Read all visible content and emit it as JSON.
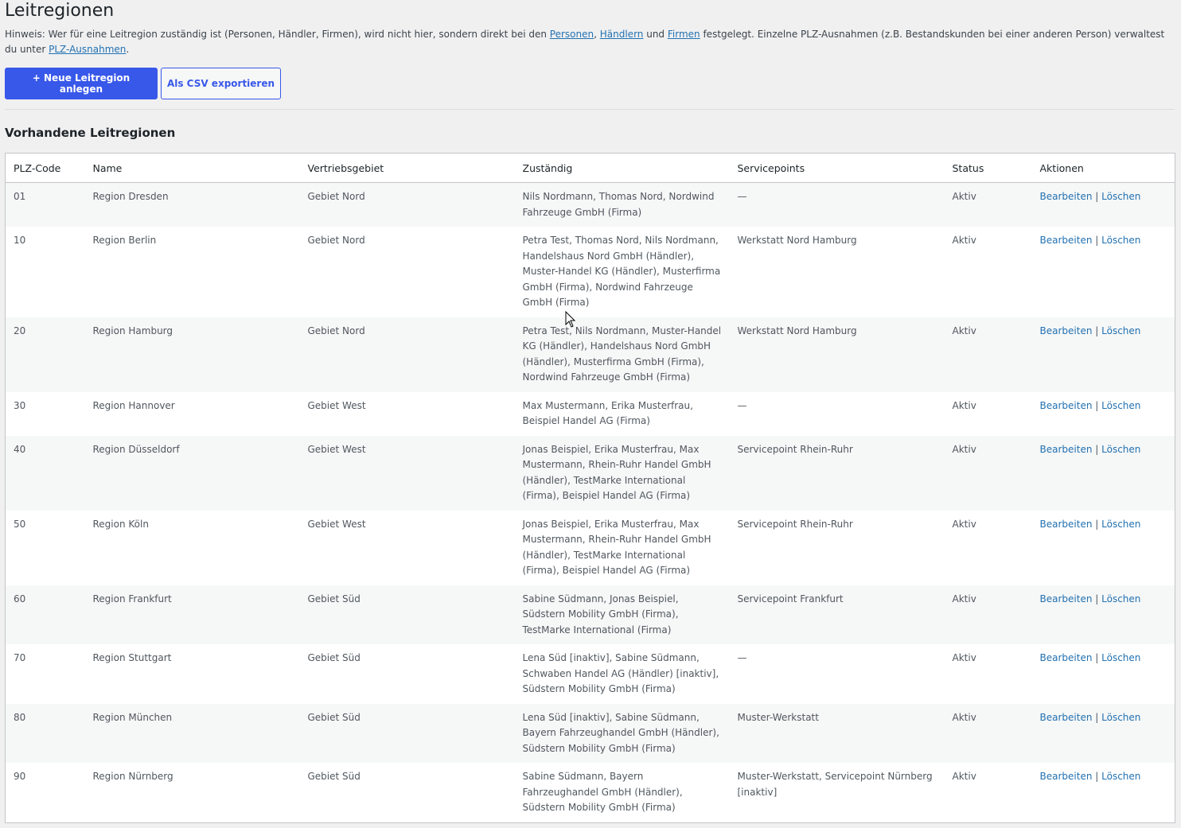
{
  "page": {
    "title": "Leitregionen",
    "hint_prefix": "Hinweis: Wer für eine Leitregion zuständig ist (Personen, Händler, Firmen), wird nicht hier, sondern direkt bei den ",
    "link_personen": "Personen",
    "comma": ",",
    "link_haendlern": "Händlern",
    "und": " und ",
    "link_firmen": "Firmen",
    "hint_mid": " festgelegt. Einzelne PLZ-Ausnahmen (z.B. Bestandskunden bei einer anderen Person) verwaltest du unter ",
    "link_ausnahmen": "PLZ-Ausnahmen",
    "hint_end": "."
  },
  "buttons": {
    "new_label": "+ Neue Leitregion anlegen",
    "export_label": "Als CSV exportieren"
  },
  "section": {
    "title": "Vorhandene Leitregionen"
  },
  "table": {
    "columns": [
      "PLZ-Code",
      "Name",
      "Vertriebsgebiet",
      "Zuständig",
      "Servicepoints",
      "Status",
      "Aktionen"
    ],
    "rows": [
      {
        "plz": "01",
        "name": "Region Dresden",
        "gebiet": "Gebiet Nord",
        "zustaendig": "Nils Nordmann, Thomas Nord, Nordwind Fahrzeuge GmbH (Firma)",
        "service": "—",
        "status": "Aktiv"
      },
      {
        "plz": "10",
        "name": "Region Berlin",
        "gebiet": "Gebiet Nord",
        "zustaendig": "Petra Test, Thomas Nord, Nils Nordmann, Handelshaus Nord GmbH (Händler), Muster-Handel KG (Händler), Musterfirma GmbH (Firma), Nordwind Fahrzeuge GmbH (Firma)",
        "service": "Werkstatt Nord Hamburg",
        "status": "Aktiv"
      },
      {
        "plz": "20",
        "name": "Region Hamburg",
        "gebiet": "Gebiet Nord",
        "zustaendig": "Petra Test, Nils Nordmann, Muster-Handel KG (Händler), Handelshaus Nord GmbH (Händler), Musterfirma GmbH (Firma), Nordwind Fahrzeuge GmbH (Firma)",
        "service": "Werkstatt Nord Hamburg",
        "status": "Aktiv"
      },
      {
        "plz": "30",
        "name": "Region Hannover",
        "gebiet": "Gebiet West",
        "zustaendig": "Max Mustermann, Erika Musterfrau, Beispiel Handel AG (Firma)",
        "service": "—",
        "status": "Aktiv"
      },
      {
        "plz": "40",
        "name": "Region Düsseldorf",
        "gebiet": "Gebiet West",
        "zustaendig": "Jonas Beispiel, Erika Musterfrau, Max Mustermann, Rhein-Ruhr Handel GmbH (Händler), TestMarke International (Firma), Beispiel Handel AG (Firma)",
        "service": "Servicepoint Rhein-Ruhr",
        "status": "Aktiv"
      },
      {
        "plz": "50",
        "name": "Region Köln",
        "gebiet": "Gebiet West",
        "zustaendig": "Jonas Beispiel, Erika Musterfrau, Max Mustermann, Rhein-Ruhr Handel GmbH (Händler), TestMarke International (Firma), Beispiel Handel AG (Firma)",
        "service": "Servicepoint Rhein-Ruhr",
        "status": "Aktiv"
      },
      {
        "plz": "60",
        "name": "Region Frankfurt",
        "gebiet": "Gebiet Süd",
        "zustaendig": "Sabine Südmann, Jonas Beispiel, Südstern Mobility GmbH (Firma), TestMarke International (Firma)",
        "service": "Servicepoint Frankfurt",
        "status": "Aktiv"
      },
      {
        "plz": "70",
        "name": "Region Stuttgart",
        "gebiet": "Gebiet Süd",
        "zustaendig": "Lena Süd [inaktiv], Sabine Südmann, Schwaben Handel AG (Händler) [inaktiv], Südstern Mobility GmbH (Firma)",
        "service": "—",
        "status": "Aktiv"
      },
      {
        "plz": "80",
        "name": "Region München",
        "gebiet": "Gebiet Süd",
        "zustaendig": "Lena Süd [inaktiv], Sabine Südmann, Bayern Fahrzeughandel GmbH (Händler), Südstern Mobility GmbH (Firma)",
        "service": "Muster-Werkstatt",
        "status": "Aktiv"
      },
      {
        "plz": "90",
        "name": "Region Nürnberg",
        "gebiet": "Gebiet Süd",
        "zustaendig": "Sabine Südmann, Bayern Fahrzeughandel GmbH (Händler), Südstern Mobility GmbH (Firma)",
        "service": "Muster-Werkstatt, Servicepoint Nürnberg [inaktiv]",
        "status": "Aktiv"
      }
    ],
    "action_edit": "Bearbeiten",
    "action_sep": "|",
    "action_delete": "Löschen"
  },
  "colors": {
    "background": "#f0f0f1",
    "primary": "#3858e9",
    "link": "#2271b1"
  }
}
